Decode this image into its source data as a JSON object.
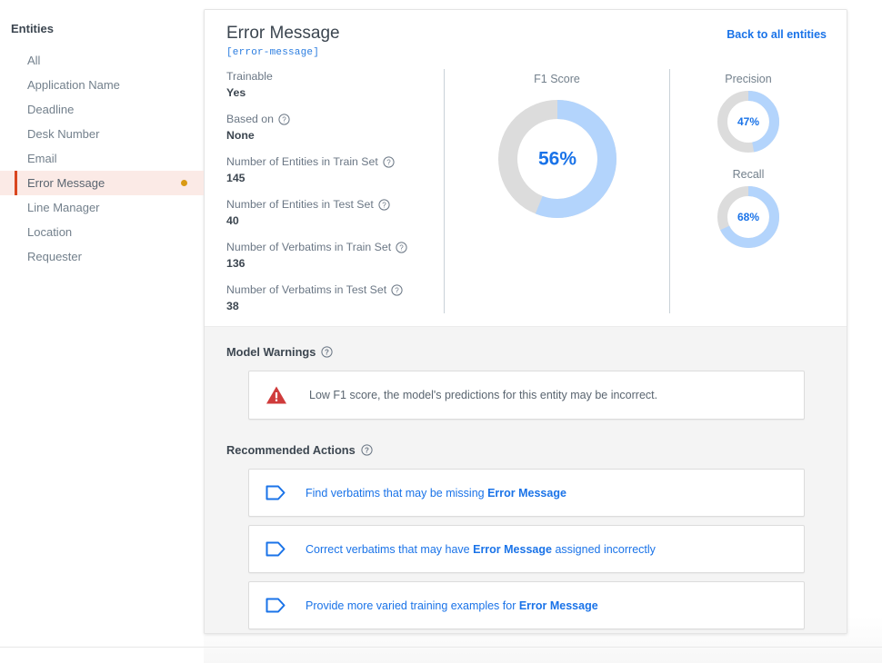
{
  "sidebar": {
    "title": "Entities",
    "items": [
      {
        "label": "All",
        "active": false,
        "dot": false
      },
      {
        "label": "Application Name",
        "active": false,
        "dot": false
      },
      {
        "label": "Deadline",
        "active": false,
        "dot": false
      },
      {
        "label": "Desk Number",
        "active": false,
        "dot": false
      },
      {
        "label": "Email",
        "active": false,
        "dot": false
      },
      {
        "label": "Error Message",
        "active": true,
        "dot": true
      },
      {
        "label": "Line Manager",
        "active": false,
        "dot": false
      },
      {
        "label": "Location",
        "active": false,
        "dot": false
      },
      {
        "label": "Requester",
        "active": false,
        "dot": false
      }
    ]
  },
  "header": {
    "title": "Error Message",
    "slug": "[error-message]",
    "back_link": "Back to all entities"
  },
  "stats": [
    {
      "label": "Trainable",
      "value": "Yes",
      "help": false
    },
    {
      "label": "Based on",
      "value": "None",
      "help": true
    },
    {
      "label": "Number of Entities in Train Set",
      "value": "145",
      "help": true
    },
    {
      "label": "Number of Entities in Test Set",
      "value": "40",
      "help": true
    },
    {
      "label": "Number of Verbatims in Train Set",
      "value": "136",
      "help": true
    },
    {
      "label": "Number of Verbatims in Test Set",
      "value": "38",
      "help": true
    }
  ],
  "metrics": {
    "f1": {
      "caption": "F1 Score",
      "display": "56%",
      "percent": 56
    },
    "precision": {
      "caption": "Precision",
      "display": "47%",
      "percent": 47
    },
    "recall": {
      "caption": "Recall",
      "display": "68%",
      "percent": 68
    }
  },
  "warnings": {
    "heading": "Model Warnings",
    "items": [
      {
        "icon": "warning-triangle-icon",
        "text": "Low F1 score, the model's predictions for this entity may be incorrect."
      }
    ]
  },
  "recommended_actions": {
    "heading": "Recommended Actions",
    "items": [
      {
        "icon": "tag-icon",
        "prefix": "Find verbatims that may be missing ",
        "entity": "Error Message",
        "suffix": ""
      },
      {
        "icon": "tag-icon",
        "prefix": "Correct verbatims that may have ",
        "entity": "Error Message",
        "suffix": " assigned incorrectly"
      },
      {
        "icon": "tag-icon",
        "prefix": "Provide more varied training examples for ",
        "entity": "Error Message",
        "suffix": ""
      }
    ]
  },
  "colors": {
    "accent_blue": "#1a73e8",
    "donut_fill": "#b3d4fc",
    "donut_track": "#dcdcdc",
    "warning_red": "#cf3b3b",
    "active_border": "#d9461f",
    "active_bg": "#fbeae6",
    "status_dot": "#d99a14"
  },
  "chart_data": [
    {
      "type": "pie",
      "title": "F1 Score",
      "categories": [
        "Score",
        "Remainder"
      ],
      "values": [
        56,
        44
      ],
      "value_label": "56%",
      "unit": "%",
      "donut": true,
      "legend": "none"
    },
    {
      "type": "pie",
      "title": "Precision",
      "categories": [
        "Score",
        "Remainder"
      ],
      "values": [
        47,
        53
      ],
      "value_label": "47%",
      "unit": "%",
      "donut": true,
      "legend": "none"
    },
    {
      "type": "pie",
      "title": "Recall",
      "categories": [
        "Score",
        "Remainder"
      ],
      "values": [
        68,
        32
      ],
      "value_label": "68%",
      "unit": "%",
      "donut": true,
      "legend": "none"
    }
  ]
}
